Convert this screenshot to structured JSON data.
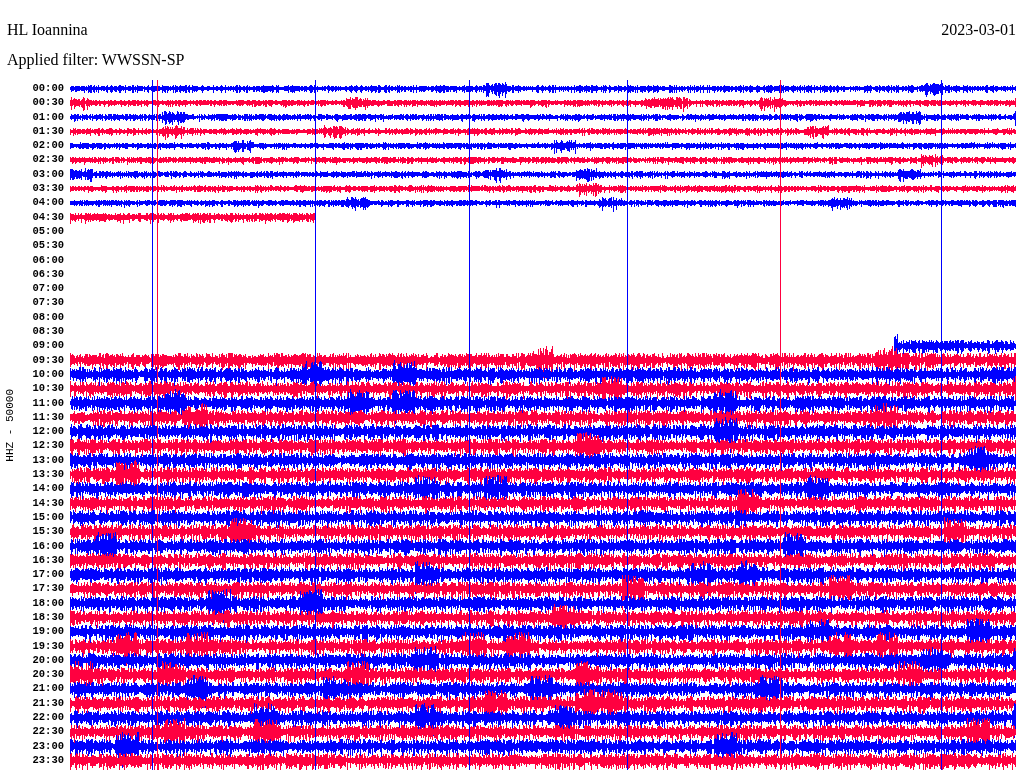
{
  "station": "HL Ioannina",
  "date": "2023-03-01",
  "filter": "Applied filter: WWSSN-SP",
  "channel_label": "HHZ - 50000",
  "rows": [
    {
      "label": "00:00",
      "color": "#0000ff"
    },
    {
      "label": "00:30",
      "color": "#ff0040"
    },
    {
      "label": "01:00",
      "color": "#0000ff"
    },
    {
      "label": "01:30",
      "color": "#ff0040"
    },
    {
      "label": "02:00",
      "color": "#0000ff"
    },
    {
      "label": "02:30",
      "color": "#ff0040"
    },
    {
      "label": "03:00",
      "color": "#0000ff"
    },
    {
      "label": "03:30",
      "color": "#ff0040"
    },
    {
      "label": "04:00",
      "color": "#0000ff"
    },
    {
      "label": "04:30",
      "color": "#ff0040"
    },
    {
      "label": "05:00"
    },
    {
      "label": "05:30"
    },
    {
      "label": "06:00"
    },
    {
      "label": "06:30"
    },
    {
      "label": "07:00"
    },
    {
      "label": "07:30"
    },
    {
      "label": "08:00"
    },
    {
      "label": "08:30"
    },
    {
      "label": "09:00",
      "color": "#0000ff"
    },
    {
      "label": "09:30",
      "color": "#ff0040"
    },
    {
      "label": "10:00",
      "color": "#0000ff"
    },
    {
      "label": "10:30",
      "color": "#ff0040"
    },
    {
      "label": "11:00",
      "color": "#0000ff"
    },
    {
      "label": "11:30",
      "color": "#ff0040"
    },
    {
      "label": "12:00",
      "color": "#0000ff"
    },
    {
      "label": "12:30",
      "color": "#ff0040"
    },
    {
      "label": "13:00",
      "color": "#0000ff"
    },
    {
      "label": "13:30",
      "color": "#ff0040"
    },
    {
      "label": "14:00",
      "color": "#0000ff"
    },
    {
      "label": "14:30",
      "color": "#ff0040"
    },
    {
      "label": "15:00",
      "color": "#0000ff"
    },
    {
      "label": "15:30",
      "color": "#ff0040"
    },
    {
      "label": "16:00",
      "color": "#0000ff"
    },
    {
      "label": "16:30",
      "color": "#ff0040"
    },
    {
      "label": "17:00",
      "color": "#0000ff"
    },
    {
      "label": "17:30",
      "color": "#ff0040"
    },
    {
      "label": "18:00",
      "color": "#0000ff"
    },
    {
      "label": "18:30",
      "color": "#ff0040"
    },
    {
      "label": "19:00",
      "color": "#0000ff"
    },
    {
      "label": "19:30",
      "color": "#ff0040"
    },
    {
      "label": "20:00",
      "color": "#0000ff"
    },
    {
      "label": "20:30",
      "color": "#ff0040"
    },
    {
      "label": "21:00",
      "color": "#0000ff"
    },
    {
      "label": "21:30",
      "color": "#ff0040"
    },
    {
      "label": "22:00",
      "color": "#0000ff"
    },
    {
      "label": "22:30",
      "color": "#ff0040"
    },
    {
      "label": "23:00",
      "color": "#0000ff"
    },
    {
      "label": "23:30",
      "color": "#ff0040"
    }
  ]
}
